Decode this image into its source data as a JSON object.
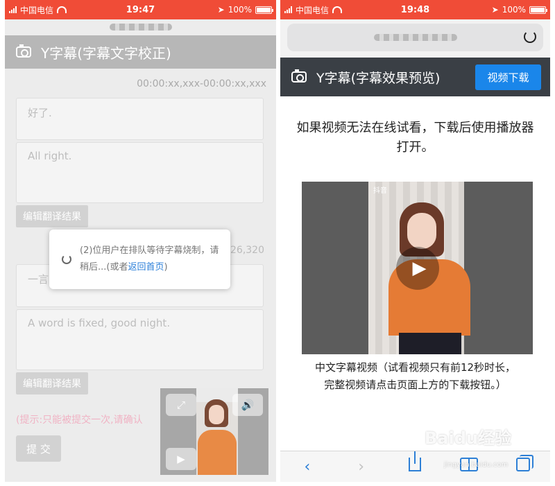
{
  "left": {
    "status": {
      "carrier": "中国电信",
      "time": "19:47",
      "battery": "100%"
    },
    "header_title": "Y字幕(字幕文字校正)",
    "timestamp": "00:00:xx,xxx-00:00:xx,xxx",
    "segments": [
      {
        "source": "好了.",
        "translation": "All right.",
        "edit_label": "编辑翻译结果"
      },
      {
        "source": "一言",
        "translation": "A word is fixed, good night.",
        "edit_label": "编辑翻译结果"
      }
    ],
    "partial_number": "26,320",
    "dialog": {
      "message": "(2)位用户在排队等待字幕烧制，请稍后...(或者",
      "link": "返回首页",
      "suffix": ")"
    },
    "hint": "(提示:只能被提交一次,请确认",
    "submit_label": "提 交"
  },
  "right": {
    "status": {
      "carrier": "中国电信",
      "time": "19:48",
      "battery": "100%"
    },
    "header_title": "Y字幕(字幕效果预览)",
    "download_button": "视频下载",
    "message": "如果视频无法在线试看，下载后使用播放器打开。",
    "video_logo": "抖音",
    "caption_line1": "中文字幕视频（试看视频只有前12秒时长，",
    "caption_line2": "完整视频请点击页面上方的下载按钮。）"
  },
  "watermark": {
    "brand": "Baidu经验",
    "url": "jingyan.baidu.com"
  },
  "colors": {
    "statusbar": "#f04c37",
    "header_dark": "#3a3f45",
    "accent_blue": "#1a86ea",
    "link": "#2a7ed8"
  }
}
